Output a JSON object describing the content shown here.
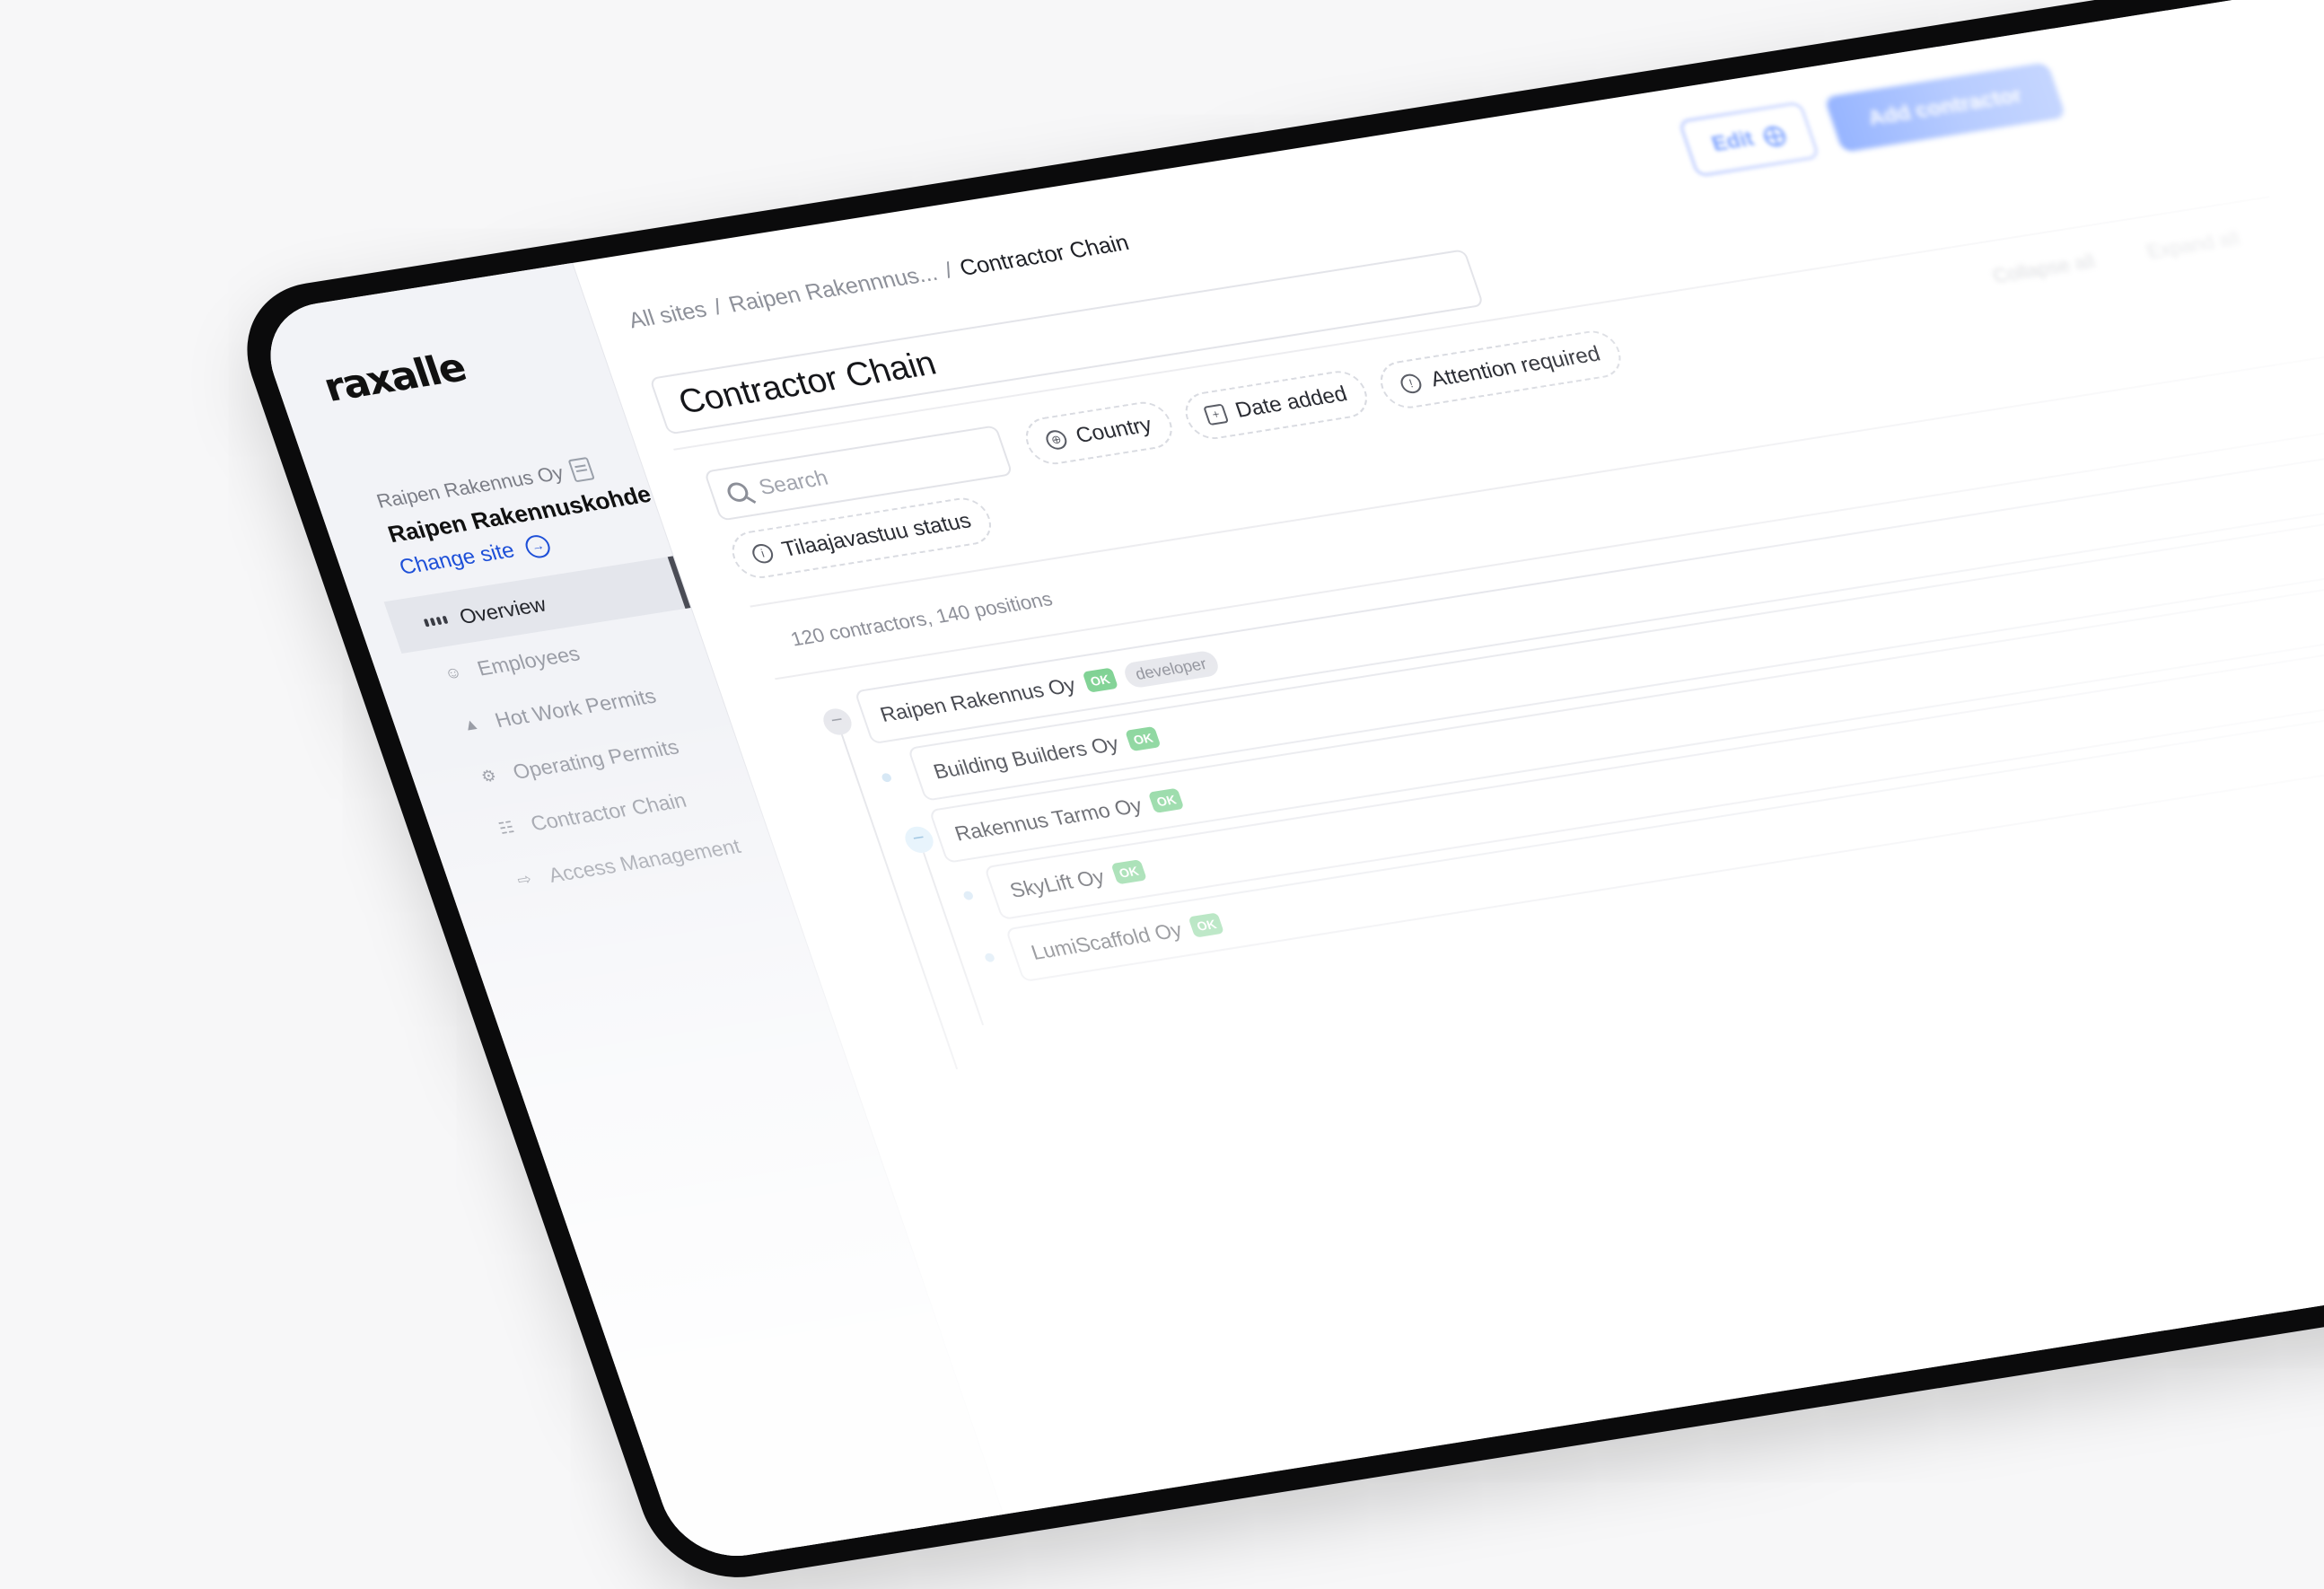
{
  "brand": {
    "logo": "raxalle"
  },
  "sidebar": {
    "org_name": "Raipen Rakennus Oy",
    "site_name": "Raipen Rakennuskohde",
    "change_site": "Change site",
    "items": [
      {
        "label": "Overview",
        "icon": "grid-icon"
      },
      {
        "label": "Employees",
        "icon": "users-icon"
      },
      {
        "label": "Hot Work Permits",
        "icon": "flame-icon"
      },
      {
        "label": "Operating Permits",
        "icon": "forklift-icon"
      },
      {
        "label": "Contractor Chain",
        "icon": "hierarchy-icon"
      },
      {
        "label": "Access Management",
        "icon": "login-icon"
      }
    ]
  },
  "header": {
    "breadcrumb": [
      "All sites",
      "Raipen Rakennnus...",
      "Contractor Chain"
    ],
    "edit_label": "Edit",
    "primary_label": "Add contractor"
  },
  "main": {
    "title": "Contractor Chain",
    "search_placeholder": "Search",
    "filters": [
      {
        "label": "Country",
        "icon": "globe-icon"
      },
      {
        "label": "Date added",
        "icon": "calendar-icon"
      },
      {
        "label": "Attention required",
        "icon": "alert-icon"
      }
    ],
    "filters_row2": [
      {
        "label": "Tilaajavastuu status",
        "icon": "info-icon"
      }
    ],
    "tools": [
      "Collapse all",
      "Expand all"
    ],
    "count": "120 contractors, 140 positions",
    "tree": [
      {
        "name": "Raipen Rakennus Oy",
        "badge": "OK",
        "role": "developer"
      },
      {
        "name": "Building Builders Oy",
        "badge": "OK"
      },
      {
        "name": "Rakennus Tarmo Oy",
        "badge": "OK"
      },
      {
        "name": "SkyLift Oy",
        "badge": "OK"
      },
      {
        "name": "LumiScaffold Oy",
        "badge": "OK"
      }
    ]
  }
}
